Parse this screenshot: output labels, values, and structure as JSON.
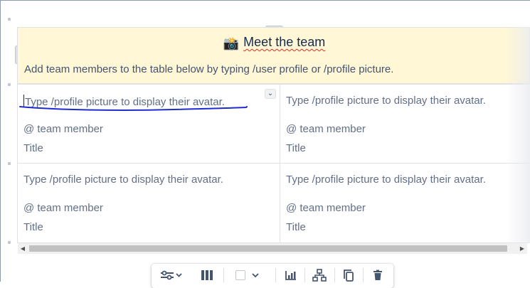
{
  "table": {
    "header": {
      "emoji": "📸",
      "title": "Meet the team",
      "description": "Add team members to the table below by typing /user profile or /profile picture."
    },
    "rows": [
      [
        {
          "avatar_hint": "Type /profile picture to display their avatar.",
          "member": "@ team member",
          "title": "Title"
        },
        {
          "avatar_hint": "Type /profile picture to display their avatar.",
          "member": "@ team member",
          "title": "Title"
        }
      ],
      [
        {
          "avatar_hint": "Type /profile picture to display their avatar.",
          "member": "@ team member",
          "title": "Title"
        },
        {
          "avatar_hint": "Type /profile picture to display their avatar.",
          "member": "@ team member",
          "title": "Title"
        }
      ]
    ]
  },
  "toolbar": {
    "buttons": [
      "table-options",
      "column-layout",
      "cell-background",
      "insert-chart",
      "sort-hierarchy",
      "copy-table",
      "delete-table"
    ]
  },
  "colors": {
    "header_bg": "#fff7d6",
    "annotation_stroke": "#1f2bd1",
    "border": "#dfe1e6"
  }
}
